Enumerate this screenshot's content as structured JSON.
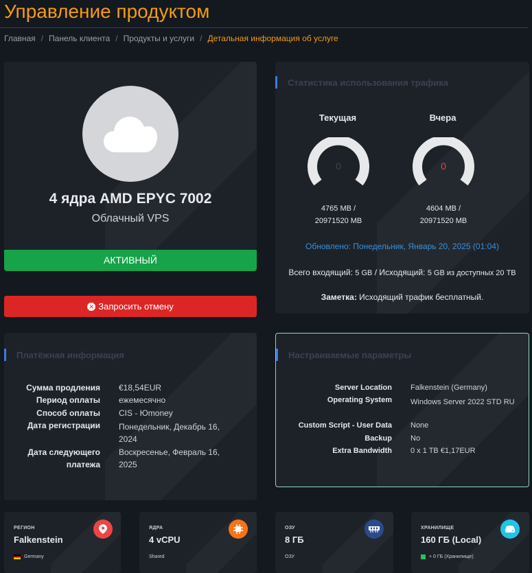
{
  "page": {
    "title": "Управление продуктом",
    "breadcrumb": [
      "Главная",
      "Панель клиента",
      "Продукты и услуги",
      "Детальная информация об услуге"
    ]
  },
  "product": {
    "icon": "cloud-icon",
    "name": "4 ядра AMD EPYC 7002",
    "group": "Облачный VPS",
    "status": "АКТИВНЫЙ",
    "cancel_label": "Запросить отмену"
  },
  "traffic": {
    "heading": "Статистика использования трафика",
    "current": {
      "label": "Текущая",
      "value": "0",
      "used": "4765 MB /",
      "total": "20971520 MB"
    },
    "yesterday": {
      "label": "Вчера",
      "value": "0",
      "used": "4604 MB /",
      "total": "20971520 MB"
    },
    "updated": "Обновлено: Понедельник, Январь 20, 2025 (01:04)",
    "total_in_label": "Всего входящий:",
    "total_in_value": "5 GB",
    "total_out_label": "/ Исходящий:",
    "total_out_value": "5 GB из доступных 20 TB",
    "note_label": "Заметка:",
    "note_text": "Исходящий трафик бесплатный."
  },
  "billing": {
    "heading": "Платёжная информация",
    "rows": [
      {
        "key": "Сумма продления",
        "value": "€18,54EUR"
      },
      {
        "key": "Период оплаты",
        "value": "ежемесячно"
      },
      {
        "key": "Способ оплаты",
        "value": "CIS - Юmoney"
      },
      {
        "key": "Дата регистрации",
        "value": "Понедельник, Декабрь 16, 2024"
      },
      {
        "key": "Дата следующего платежа",
        "value": "Воскресенье, Февраль 16, 2025"
      }
    ]
  },
  "config": {
    "heading": "Настраиваемые параметры",
    "rows": [
      {
        "key": "Server Location",
        "value": "Falkenstein (Germany)"
      },
      {
        "key": "Operating System",
        "value": "Windows Server 2022 STD RU"
      },
      {
        "key": "Custom Script - User Data",
        "value": "None"
      },
      {
        "key": "Backup",
        "value": "No"
      },
      {
        "key": "Extra Bandwidth",
        "value": "0 x 1 TB €1,17EUR"
      }
    ]
  },
  "tiles": [
    {
      "label": "РЕГИОН",
      "value": "Falkenstein",
      "sub": "Germany",
      "icon": "map-pin-icon",
      "color": "#ef4444"
    },
    {
      "label": "ЯДРА",
      "value": "4 vCPU",
      "sub": "Shared",
      "icon": "cpu-icon",
      "color": "#f97316"
    },
    {
      "label": "ОЗУ",
      "value": "8 ГБ",
      "sub": "ОЗУ",
      "icon": "ram-icon",
      "color": "#2c4a8a"
    },
    {
      "label": "ХРАНИЛИЩЕ",
      "value": "160 ГБ (Local)",
      "sub": "+ 0 ГБ (Хранилище)",
      "icon": "storage-icon",
      "color": "#22c3e6"
    }
  ],
  "colors": {
    "accent": "#f39c12",
    "active": "#16a34a",
    "danger": "#dc2626",
    "link": "#3b8fd9"
  }
}
